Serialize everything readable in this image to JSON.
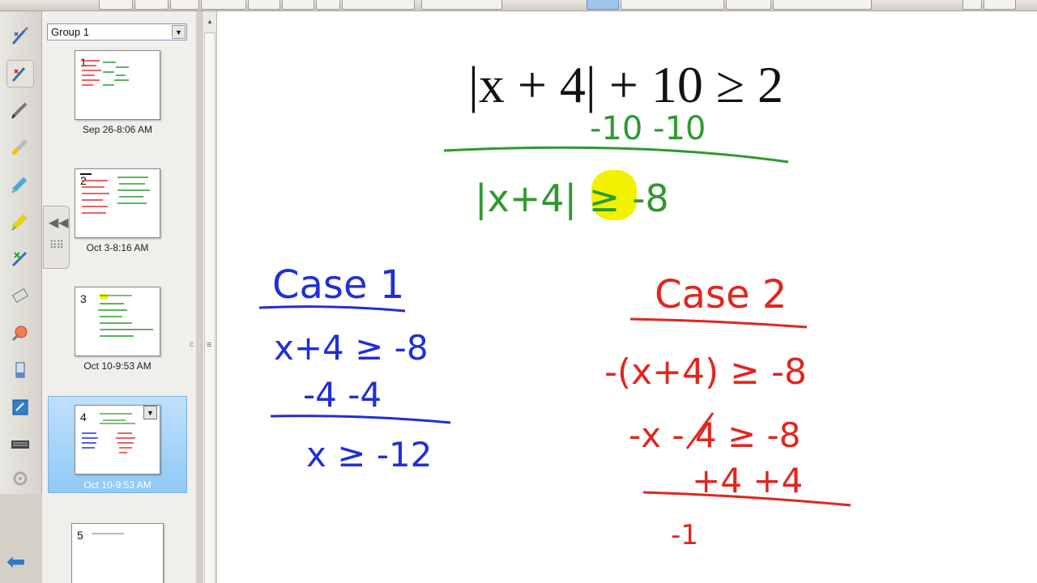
{
  "sorter": {
    "group_label": "Group 1",
    "pages": [
      {
        "number": "1",
        "label": "Sep 26-8:06 AM"
      },
      {
        "number": "2",
        "label": "Oct 3-8:16 AM"
      },
      {
        "number": "3",
        "label": "Oct 10-9:53 AM"
      },
      {
        "number": "4",
        "label": "Oct 10-9:53 AM",
        "selected": true
      },
      {
        "number": "5",
        "label": ""
      }
    ]
  },
  "canvas": {
    "equation": "|x + 4| + 10 ≥ 2",
    "step_subtract": "-10 -10",
    "result": "|x+4| ≥ -8",
    "case1": {
      "title": "Case 1",
      "line1": "x+4 ≥ -8",
      "line2": "-4  -4",
      "line3": "x ≥ -12"
    },
    "case2": {
      "title": "Case 2",
      "line1": "-(x+4) ≥ -8",
      "line2": "-x - 4 ≥ -8",
      "line3": "+4   +4",
      "line4": "-1"
    }
  },
  "colors": {
    "green_ink": "#2e9a2e",
    "blue_ink": "#1f2fd6",
    "red_ink": "#e0261f",
    "highlight": "#f2f200",
    "selection_blue": "#9ccdf3"
  }
}
